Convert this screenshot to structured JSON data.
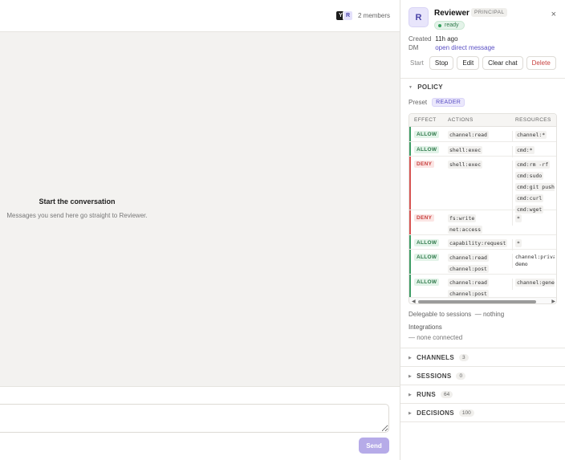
{
  "chat": {
    "members": {
      "avatars": [
        "Y",
        "R"
      ],
      "count_label": "2 members"
    },
    "empty_state": {
      "title": "Start the conversation",
      "subtitle": "Messages you send here go straight to Reviewer."
    },
    "composer": {
      "value": "",
      "send_label": "Send"
    }
  },
  "agent": {
    "avatar": "R",
    "name": "Reviewer",
    "role": "PRINCIPAL",
    "status": "ready",
    "created_label": "Created",
    "created_value": "11h ago",
    "dm_label": "DM",
    "dm_link": "open direct message",
    "close_icon": "×",
    "actions": {
      "start": "Start",
      "stop": "Stop",
      "edit": "Edit",
      "clear_chat": "Clear chat",
      "delete": "Delete"
    }
  },
  "policy": {
    "title": "POLICY",
    "preset_label": "Preset",
    "preset_value": "READER",
    "columns": {
      "effect": "EFFECT",
      "actions": "ACTIONS",
      "resources": "RESOURCES"
    },
    "rows": [
      {
        "effect": "ALLOW",
        "actions": [
          "channel:read"
        ],
        "resources": [
          "channel:*"
        ]
      },
      {
        "effect": "ALLOW",
        "actions": [
          "shell:exec"
        ],
        "resources": [
          "cmd:*"
        ]
      },
      {
        "effect": "DENY",
        "actions": [
          "shell:exec"
        ],
        "resources": [
          "cmd:rm -rf",
          "cmd:sudo",
          "cmd:git push",
          "cmd:curl",
          "cmd:wget"
        ]
      },
      {
        "effect": "DENY",
        "actions": [
          "fs:write",
          "net:access"
        ],
        "resources": [
          "*"
        ]
      },
      {
        "effect": "ALLOW",
        "actions": [
          "capability:request"
        ],
        "resources": [
          "*"
        ]
      },
      {
        "effect": "ALLOW",
        "actions": [
          "channel:read",
          "channel:post"
        ],
        "resources": [
          "channel:priva",
          "demo"
        ]
      },
      {
        "effect": "ALLOW",
        "actions": [
          "channel:read",
          "channel:post"
        ],
        "resources": [
          "channel:gener"
        ]
      }
    ],
    "delegable": "Delegable to sessions  — nothing",
    "integrations_label": "Integrations",
    "integrations_value": "— none connected"
  },
  "sections": [
    {
      "label": "CHANNELS",
      "count": "3"
    },
    {
      "label": "SESSIONS",
      "count": "0"
    },
    {
      "label": "RUNS",
      "count": "64"
    },
    {
      "label": "DECISIONS",
      "count": "100"
    }
  ],
  "colors": {
    "accent": "#5a4fc4",
    "allow": "#3e9d66",
    "deny": "#d75553",
    "send_button": "#b6abe8"
  }
}
